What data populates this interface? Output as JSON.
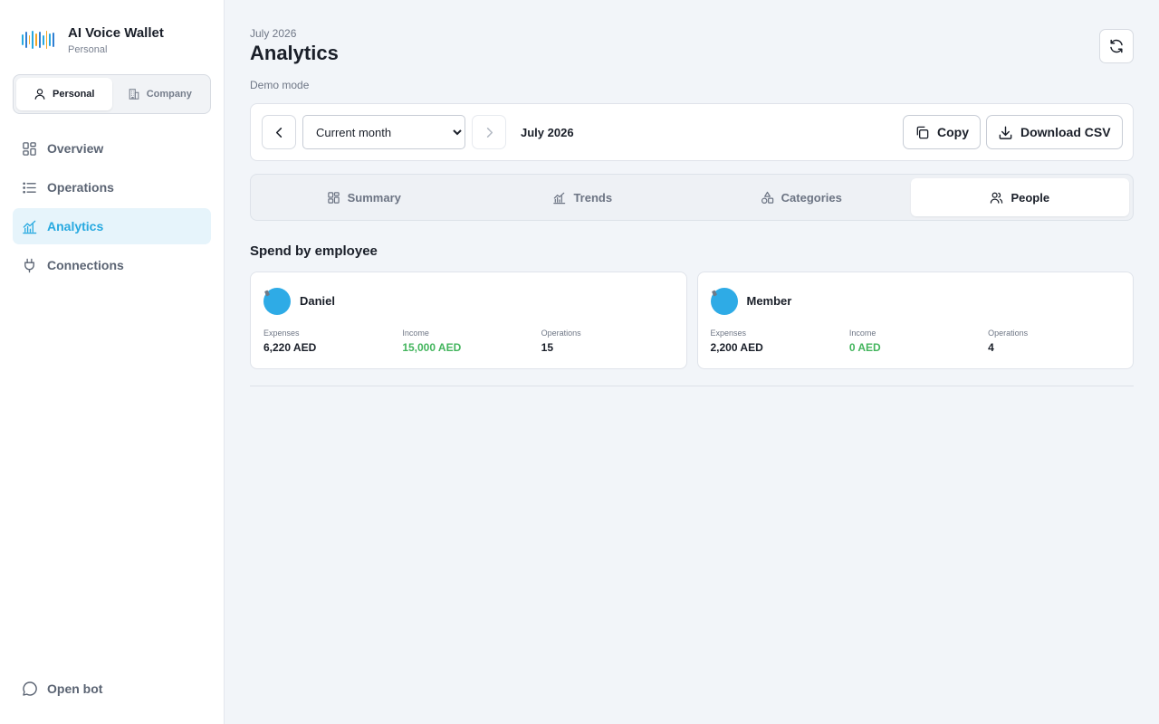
{
  "app": {
    "title": "AI Voice Wallet",
    "subtitle": "Personal",
    "brand_colors": [
      "#27a9e0",
      "#2f7fd3",
      "#f5a623",
      "#27a9e0",
      "#f5a623",
      "#2f7fd3",
      "#27a9e0",
      "#f5a623",
      "#27a9e0",
      "#2f7fd3"
    ]
  },
  "mode_toggle": [
    {
      "label": "Personal",
      "icon": "user-icon",
      "active": true
    },
    {
      "label": "Company",
      "icon": "building-icon",
      "active": false
    }
  ],
  "nav": {
    "items": [
      {
        "label": "Overview",
        "icon": "grid-icon",
        "active": false
      },
      {
        "label": "Operations",
        "icon": "list-icon",
        "active": false
      },
      {
        "label": "Analytics",
        "icon": "chart-icon",
        "active": true
      },
      {
        "label": "Connections",
        "icon": "plug-icon",
        "active": false
      }
    ],
    "open_bot": "Open bot"
  },
  "header": {
    "period_small": "July 2026",
    "title": "Analytics",
    "demo_mode": "Demo mode"
  },
  "toolbar": {
    "period_select": {
      "selected": "Current month",
      "options": [
        "Current month"
      ]
    },
    "period_label": "July 2026",
    "copy_label": "Copy",
    "download_label": "Download CSV"
  },
  "tabs": [
    {
      "label": "Summary",
      "icon": "dashboard-icon",
      "active": false
    },
    {
      "label": "Trends",
      "icon": "trend-icon",
      "active": false
    },
    {
      "label": "Categories",
      "icon": "shapes-icon",
      "active": false
    },
    {
      "label": "People",
      "icon": "people-icon",
      "active": true
    }
  ],
  "section": {
    "title": "Spend by employee",
    "labels": {
      "expenses": "Expenses",
      "income": "Income",
      "operations": "Operations"
    }
  },
  "employees": [
    {
      "name": "Daniel",
      "expenses": "6,220 AED",
      "income": "15,000 AED",
      "operations": "15"
    },
    {
      "name": "Member",
      "expenses": "2,200 AED",
      "income": "0 AED",
      "operations": "4"
    }
  ],
  "colors": {
    "accent": "#27a9e0",
    "income": "#43b55d",
    "avatar": "#2eabe6"
  }
}
